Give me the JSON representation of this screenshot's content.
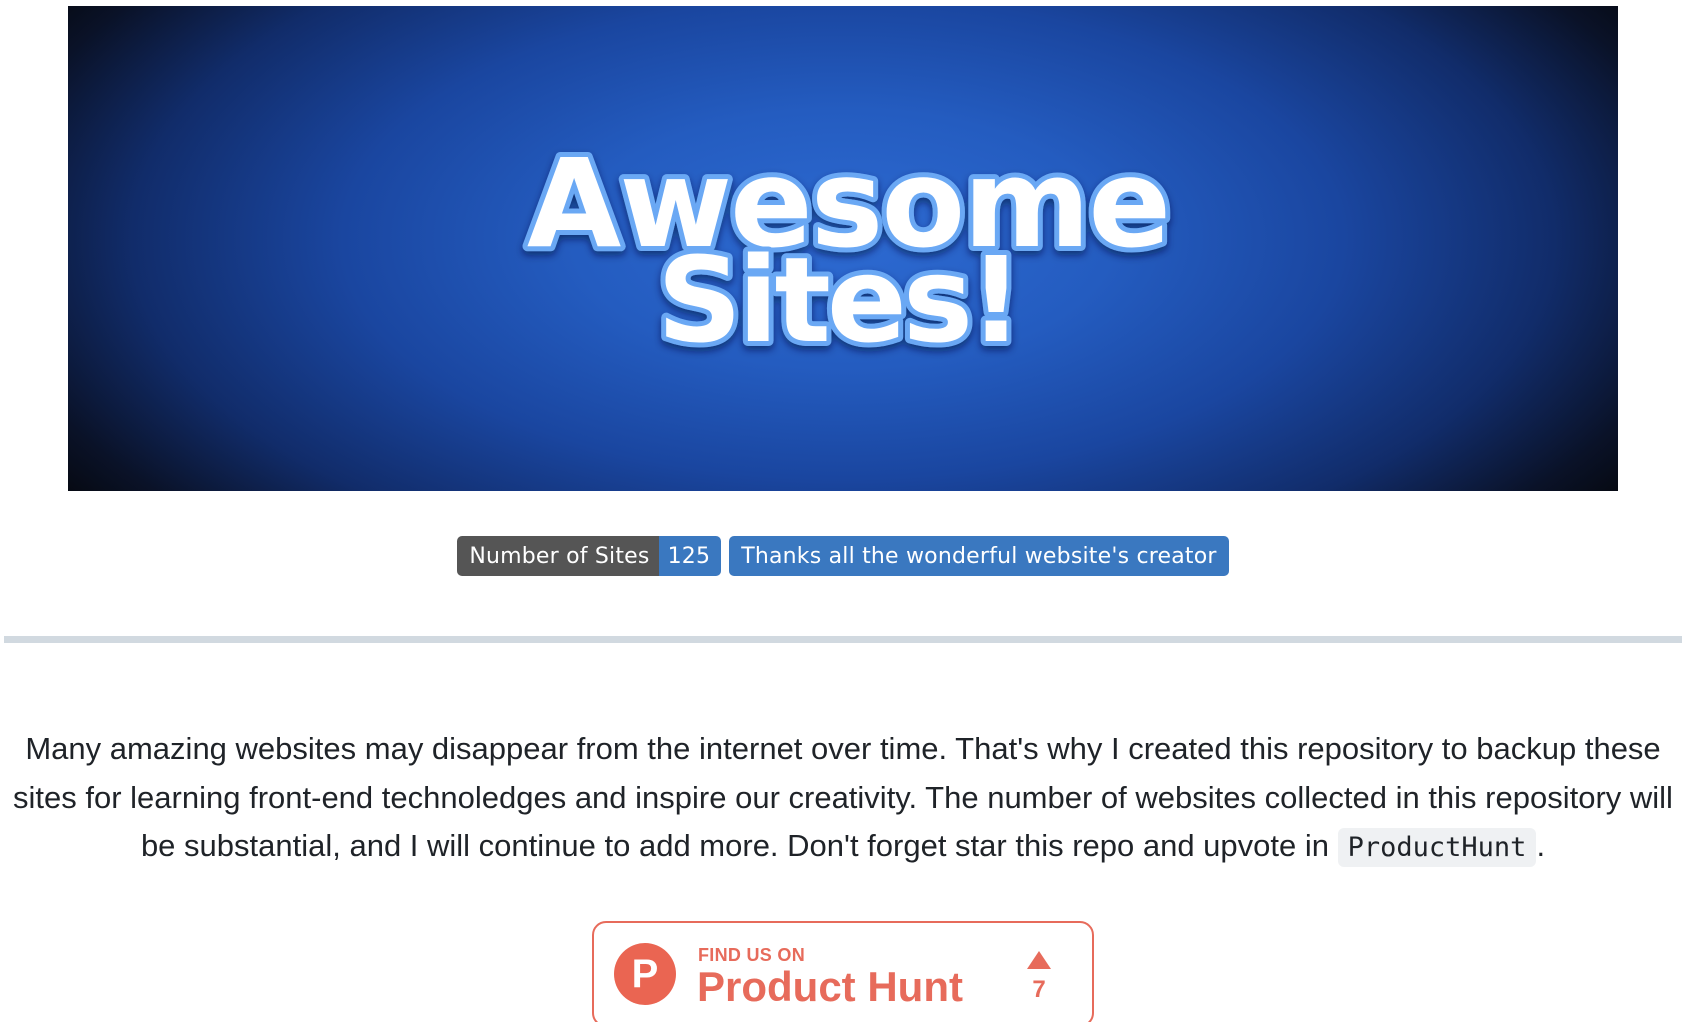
{
  "banner": {
    "logo_line1": "Awesome",
    "logo_line2": "Sites!"
  },
  "badges": {
    "sites_label": "Number of Sites",
    "sites_count": "125",
    "thanks": "Thanks all the wonderful website's creator"
  },
  "intro": {
    "text": "Many amazing websites may disappear from the internet over time. That's why I created this repository to backup these sites for learning front-end technoledges and inspire our creativity. The number of websites collected in this repository will be substantial, and I will continue to add more. Don't forget star this repo and upvote in ",
    "code": "ProductHunt",
    "end": "."
  },
  "product_hunt": {
    "logo_letter": "P",
    "small_text": "FIND US ON",
    "big_text": "Product Hunt",
    "upvotes": "7",
    "icon": "upvote-triangle-icon"
  },
  "colors": {
    "badge_label_bg": "#555555",
    "badge_value_bg": "#3a78c0",
    "product_hunt": "#e76b5b",
    "divider": "#d1d9e0"
  }
}
